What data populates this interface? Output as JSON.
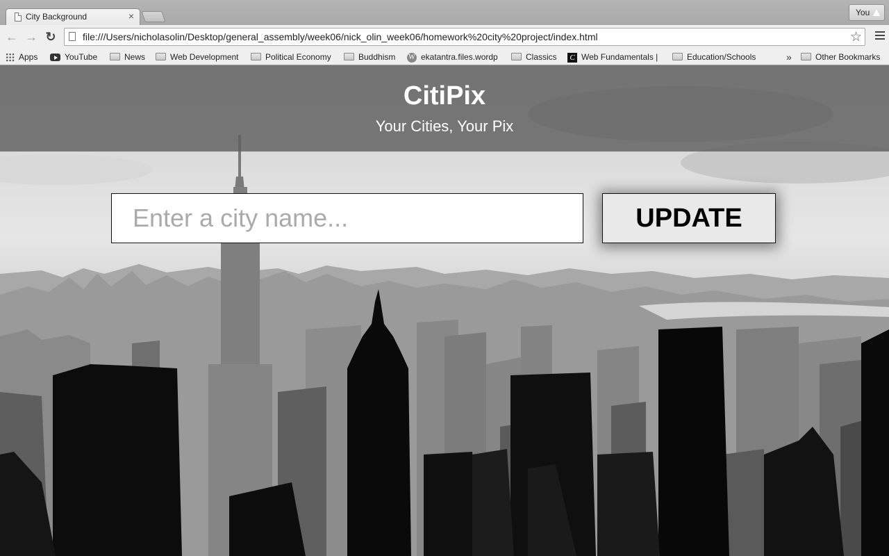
{
  "browser": {
    "tab_title": "City Background",
    "tab_close": "×",
    "profile_label": "You",
    "url": "file:///Users/nicholasolin/Desktop/general_assembly/week06/nick_olin_week06/homework%20city%20project/index.html",
    "star_glyph": "☆",
    "back_glyph": "←",
    "forward_glyph": "→",
    "reload_glyph": "↻"
  },
  "bookmarks": {
    "items": [
      {
        "label": "Apps",
        "icon": "apps-grid-icon"
      },
      {
        "label": "YouTube",
        "icon": "youtube-icon"
      },
      {
        "label": "News",
        "icon": "folder-icon"
      },
      {
        "label": "Web Development",
        "icon": "folder-icon"
      },
      {
        "label": "Political Economy",
        "icon": "folder-icon"
      },
      {
        "label": "Buddhism",
        "icon": "folder-icon"
      },
      {
        "label": "ekatantra.files.wordp",
        "icon": "wordpress-icon"
      },
      {
        "label": "Classics",
        "icon": "folder-icon"
      },
      {
        "label": "Web Fundamentals |",
        "icon": "c-logo-icon"
      },
      {
        "label": "Education/Schools",
        "icon": "folder-icon"
      }
    ],
    "overflow": "»",
    "other": "Other Bookmarks"
  },
  "page": {
    "title": "CitiPix",
    "subtitle": "Your Cities, Your Pix",
    "input_placeholder": "Enter a city name...",
    "input_value": "",
    "button_label": "UPDATE"
  }
}
